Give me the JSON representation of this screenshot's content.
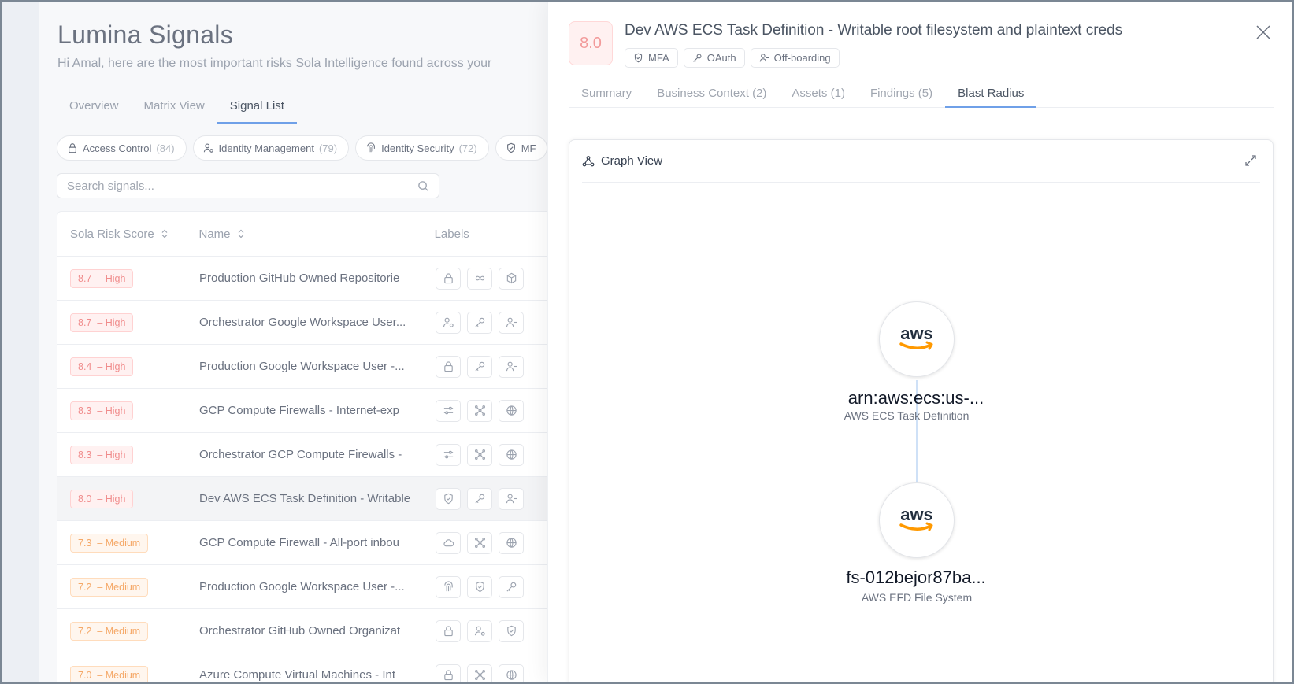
{
  "app": {
    "title": "Lumina Signals",
    "subtitle": "Hi Amal, here are the most important risks Sola Intelligence found across your"
  },
  "main_tabs": [
    {
      "label": "Overview"
    },
    {
      "label": "Matrix View"
    },
    {
      "label": "Signal List"
    }
  ],
  "chips": [
    {
      "label": "Access Control",
      "count": "(84)",
      "icon": "lock-icon"
    },
    {
      "label": "Identity Management",
      "count": "(79)",
      "icon": "user-cog-icon"
    },
    {
      "label": "Identity Security",
      "count": "(72)",
      "icon": "fingerprint-icon"
    },
    {
      "label": "MF",
      "count": "",
      "icon": "shield-icon"
    }
  ],
  "search": {
    "placeholder": "Search signals..."
  },
  "table": {
    "headers": {
      "score": "Sola Risk Score",
      "name": "Name",
      "labels": "Labels"
    },
    "rows": [
      {
        "score": "8.7",
        "level": "High",
        "name": "Production GitHub Owned Repositorie",
        "icons": [
          "lock",
          "infinity",
          "box"
        ]
      },
      {
        "score": "8.7",
        "level": "High",
        "name": "Orchestrator Google Workspace User...",
        "icons": [
          "user-cog",
          "key",
          "user-minus"
        ]
      },
      {
        "score": "8.4",
        "level": "High",
        "name": "Production Google Workspace User -...",
        "icons": [
          "lock",
          "key",
          "user-minus"
        ]
      },
      {
        "score": "8.3",
        "level": "High",
        "name": "GCP Compute Firewalls - Internet-exp",
        "icons": [
          "sliders",
          "network",
          "globe"
        ]
      },
      {
        "score": "8.3",
        "level": "High",
        "name": "Orchestrator GCP Compute Firewalls -",
        "icons": [
          "sliders",
          "network",
          "globe"
        ]
      },
      {
        "score": "8.0",
        "level": "High",
        "name": "Dev AWS ECS Task Definition - Writable",
        "icons": [
          "shield",
          "key",
          "user-minus"
        ]
      },
      {
        "score": "7.3",
        "level": "Medium",
        "name": "GCP Compute Firewall - All-port inbou",
        "icons": [
          "cloud",
          "network",
          "globe"
        ]
      },
      {
        "score": "7.2",
        "level": "Medium",
        "name": "Production Google Workspace User -...",
        "icons": [
          "fingerprint",
          "shield",
          "key"
        ]
      },
      {
        "score": "7.2",
        "level": "Medium",
        "name": "Orchestrator GitHub Owned Organizat",
        "icons": [
          "lock",
          "user-cog",
          "shield"
        ]
      },
      {
        "score": "7.0",
        "level": "Medium",
        "name": "Azure Compute Virtual Machines - Int",
        "icons": [
          "lock",
          "network",
          "globe"
        ]
      }
    ]
  },
  "drawer": {
    "score": "8.0",
    "title": "Dev AWS ECS Task Definition - Writable root filesystem and plaintext creds",
    "tags": [
      {
        "label": "MFA",
        "icon": "shield-icon"
      },
      {
        "label": "OAuth",
        "icon": "key-icon"
      },
      {
        "label": "Off-boarding",
        "icon": "user-minus-icon"
      }
    ],
    "tabs": [
      {
        "label": "Summary"
      },
      {
        "label": "Business Context (2)"
      },
      {
        "label": "Assets (1)"
      },
      {
        "label": "Findings (5)"
      },
      {
        "label": "Blast Radius"
      }
    ],
    "graph": {
      "title": "Graph View",
      "nodes": [
        {
          "logo": "aws",
          "name": "arn:aws:ecs:us-...",
          "type": "AWS ECS Task Definition"
        },
        {
          "logo": "aws",
          "name": "fs-012bejor87ba...",
          "type": "AWS EFD File System"
        }
      ]
    }
  },
  "colors": {
    "accent": "#6fa0e8",
    "high": "#f08b8b",
    "medium": "#f5a867",
    "aws_orange": "#ff9900",
    "aws_dark": "#232f3e"
  }
}
